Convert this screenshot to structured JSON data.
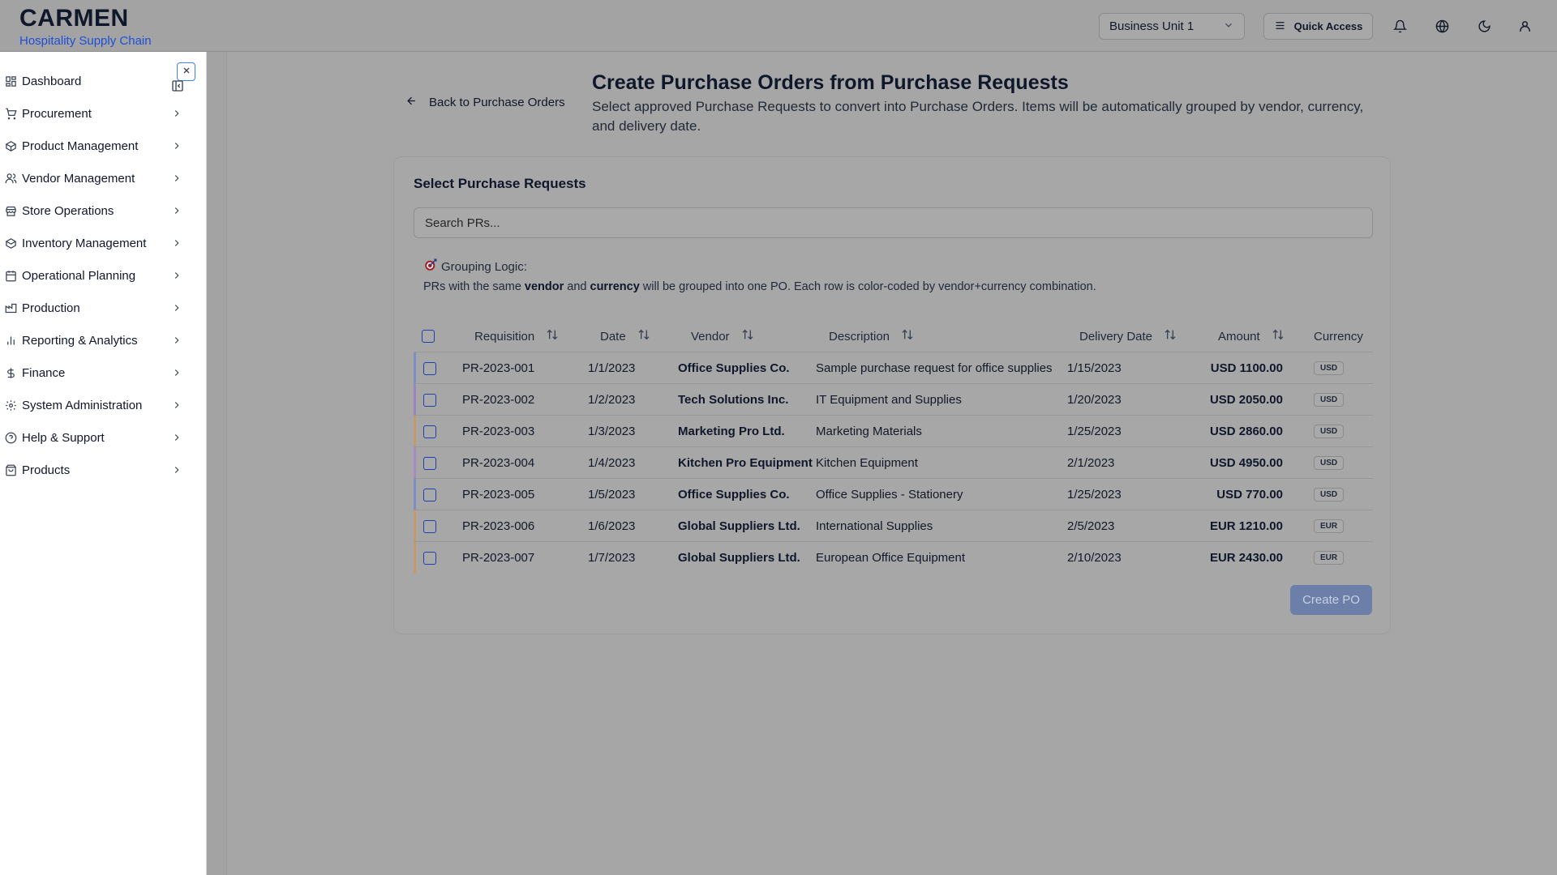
{
  "brand": {
    "title": "CARMEN",
    "subtitle": "Hospitality Supply Chain"
  },
  "header": {
    "business_unit": "Business Unit 1",
    "quick_access": "Quick Access"
  },
  "sidebar": {
    "items": [
      {
        "label": "Dashboard",
        "icon": "dashboard-icon"
      },
      {
        "label": "Procurement",
        "icon": "cart-icon"
      },
      {
        "label": "Product Management",
        "icon": "package-icon"
      },
      {
        "label": "Vendor Management",
        "icon": "users-icon"
      },
      {
        "label": "Store Operations",
        "icon": "store-icon"
      },
      {
        "label": "Inventory Management",
        "icon": "box-icon"
      },
      {
        "label": "Operational Planning",
        "icon": "calendar-icon"
      },
      {
        "label": "Production",
        "icon": "factory-icon"
      },
      {
        "label": "Reporting & Analytics",
        "icon": "bar-chart-icon"
      },
      {
        "label": "Finance",
        "icon": "dollar-icon"
      },
      {
        "label": "System Administration",
        "icon": "gear-icon"
      },
      {
        "label": "Help & Support",
        "icon": "help-icon"
      },
      {
        "label": "Products",
        "icon": "shopping-bag-icon"
      }
    ]
  },
  "page": {
    "back_label": "Back to Purchase Orders",
    "title": "Create Purchase Orders from Purchase Requests",
    "description": "Select approved Purchase Requests to convert into Purchase Orders. Items will be automatically grouped by vendor, currency, and delivery date."
  },
  "card": {
    "title": "Select Purchase Requests",
    "search_placeholder": "Search PRs...",
    "logic_title": "Grouping Logic:",
    "logic_pre": "PRs with the same ",
    "logic_vendor": "vendor",
    "logic_and": " and ",
    "logic_currency": "currency",
    "logic_post": " will be grouped into one PO. Each row is color-coded by vendor+currency combination.",
    "create_button": "Create PO"
  },
  "table": {
    "headers": {
      "requisition": "Requisition",
      "date": "Date",
      "vendor": "Vendor",
      "description": "Description",
      "delivery_date": "Delivery Date",
      "amount": "Amount",
      "currency": "Currency"
    },
    "rows": [
      {
        "requisition": "PR-2023-001",
        "date": "1/1/2023",
        "vendor": "Office Supplies Co.",
        "description": "Sample purchase request for office supplies",
        "delivery_date": "1/15/2023",
        "amount": "USD 1100.00",
        "currency": "USD",
        "color": "#7c8fc4"
      },
      {
        "requisition": "PR-2023-002",
        "date": "1/2/2023",
        "vendor": "Tech Solutions Inc.",
        "description": "IT Equipment and Supplies",
        "delivery_date": "1/20/2023",
        "amount": "USD 2050.00",
        "currency": "USD",
        "color": "#9a84c0"
      },
      {
        "requisition": "PR-2023-003",
        "date": "1/3/2023",
        "vendor": "Marketing Pro Ltd.",
        "description": "Marketing Materials",
        "delivery_date": "1/25/2023",
        "amount": "USD 2860.00",
        "currency": "USD",
        "color": "#c49a6a"
      },
      {
        "requisition": "PR-2023-004",
        "date": "1/4/2023",
        "vendor": "Kitchen Pro Equipment",
        "description": "Kitchen Equipment",
        "delivery_date": "2/1/2023",
        "amount": "USD 4950.00",
        "currency": "USD",
        "color": "#a58ac4"
      },
      {
        "requisition": "PR-2023-005",
        "date": "1/5/2023",
        "vendor": "Office Supplies Co.",
        "description": "Office Supplies - Stationery",
        "delivery_date": "1/25/2023",
        "amount": "USD 770.00",
        "currency": "USD",
        "color": "#7c8fc4"
      },
      {
        "requisition": "PR-2023-006",
        "date": "1/6/2023",
        "vendor": "Global Suppliers Ltd.",
        "description": "International Supplies",
        "delivery_date": "2/5/2023",
        "amount": "EUR 1210.00",
        "currency": "EUR",
        "color": "#c49a6a"
      },
      {
        "requisition": "PR-2023-007",
        "date": "1/7/2023",
        "vendor": "Global Suppliers Ltd.",
        "description": "European Office Equipment",
        "delivery_date": "2/10/2023",
        "amount": "EUR 2430.00",
        "currency": "EUR",
        "color": "#c49a6a"
      }
    ]
  }
}
